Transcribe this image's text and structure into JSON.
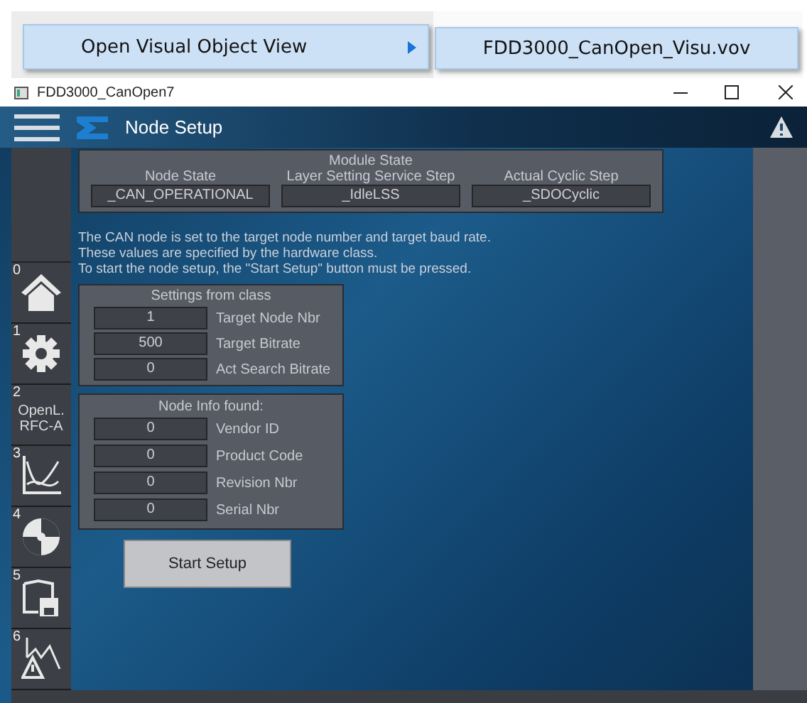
{
  "context_menu": {
    "items": [
      {
        "label": "Open Visual Object View",
        "has_submenu": true,
        "selected": true
      }
    ],
    "submenu": [
      {
        "label": "FDD3000_CanOpen_Visu.vov",
        "selected": true
      }
    ]
  },
  "window": {
    "title": "FDD3000_CanOpen7"
  },
  "header": {
    "title": "Node Setup"
  },
  "sidebar": {
    "items": [
      {
        "index": "0",
        "kind": "home"
      },
      {
        "index": "1",
        "kind": "gear"
      },
      {
        "index": "2",
        "kind": "text",
        "lines": [
          "OpenL.",
          "RFC-A"
        ]
      },
      {
        "index": "3",
        "kind": "chart"
      },
      {
        "index": "4",
        "kind": "pie"
      },
      {
        "index": "5",
        "kind": "book"
      },
      {
        "index": "6",
        "kind": "alarm"
      }
    ]
  },
  "module_state": {
    "title": "Module State",
    "fields": [
      {
        "label": "Node State",
        "value": "_CAN_OPERATIONAL"
      },
      {
        "label": "Layer Setting Service Step",
        "value": "_IdleLSS"
      },
      {
        "label": "Actual Cyclic Step",
        "value": "_SDOCyclic"
      }
    ]
  },
  "message": [
    "The CAN node is set to the target node number and target baud rate.",
    "These values are specified by the hardware class.",
    "To start the node setup, the \"Start Setup\" button must be pressed."
  ],
  "settings": {
    "title": "Settings from class",
    "rows": [
      {
        "value": "1",
        "label": "Target Node Nbr"
      },
      {
        "value": "500",
        "label": "Target Bitrate"
      },
      {
        "value": "0",
        "label": "Act Search Bitrate"
      }
    ]
  },
  "node_info": {
    "title": "Node Info found:",
    "rows": [
      {
        "value": "0",
        "label": "Vendor ID"
      },
      {
        "value": "0",
        "label": "Product Code"
      },
      {
        "value": "0",
        "label": "Revision Nbr"
      },
      {
        "value": "0",
        "label": "Serial Nbr"
      }
    ]
  },
  "start_button": "Start Setup"
}
